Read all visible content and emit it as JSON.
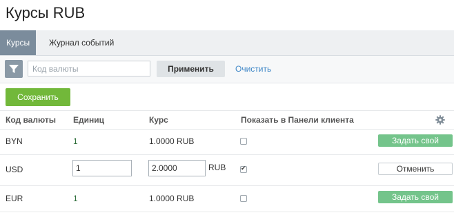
{
  "page": {
    "title": "Курсы RUB"
  },
  "tabs": [
    {
      "label": "Курсы"
    },
    {
      "label": "Журнал событий"
    }
  ],
  "filter": {
    "placeholder": "Код валюты",
    "apply_label": "Применить",
    "clear_label": "Очистить"
  },
  "toolbar": {
    "save_label": "Сохранить"
  },
  "columns": {
    "code": "Код валюты",
    "units": "Единиц",
    "rate": "Курс",
    "show": "Показать в Панели клиента"
  },
  "rows": [
    {
      "code": "BYN",
      "units": "1",
      "rate": "1.0000 RUB",
      "shown": false,
      "action": "Задать свой"
    },
    {
      "code": "USD",
      "units": "1",
      "rate": "2.0000",
      "rate_unit": "RUB",
      "shown": true,
      "action": "Отменить"
    },
    {
      "code": "EUR",
      "units": "1",
      "rate": "1.0000 RUB",
      "shown": false,
      "action": "Задать свой"
    }
  ],
  "icons": {
    "filter": "filter-icon",
    "settings": "gear-icon"
  },
  "colors": {
    "save": "#72b83a",
    "set_custom": "#74c48b",
    "active_tab": "#7b8c9c",
    "link": "#3f87c7"
  }
}
